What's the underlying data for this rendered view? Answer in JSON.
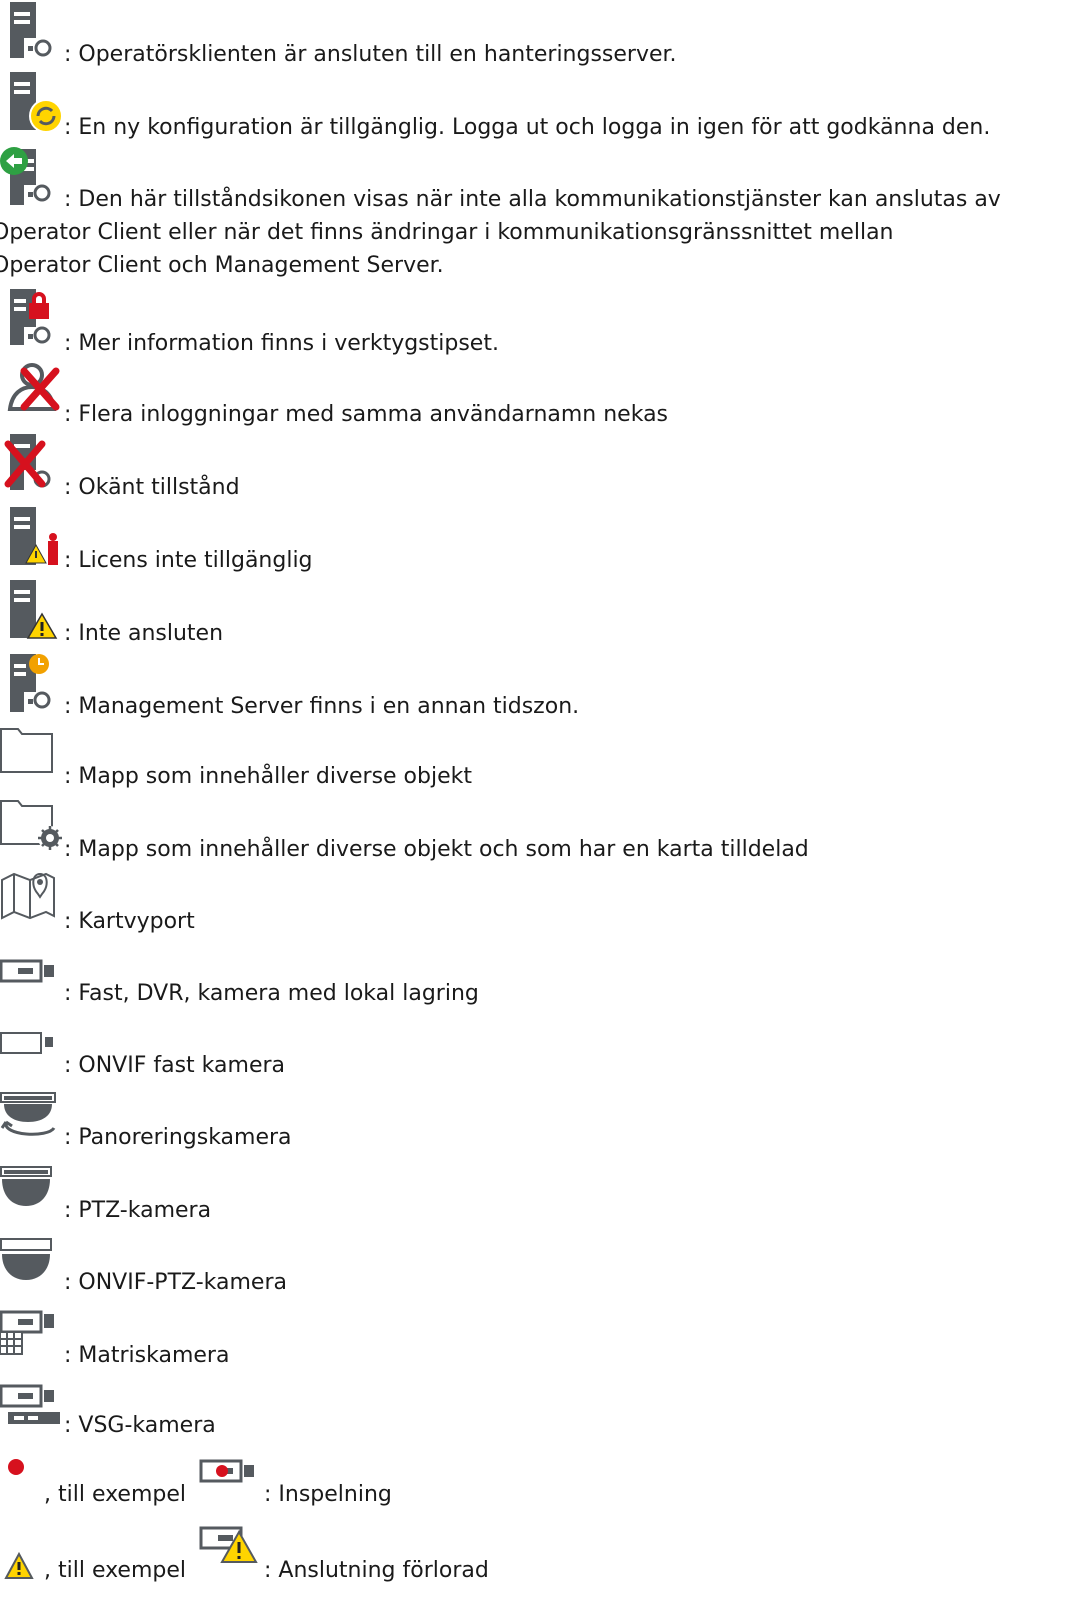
{
  "items": [
    {
      "icon": "server-connected-icon",
      "text": ": Operatörsklienten är ansluten till en hanteringsserver."
    },
    {
      "icon": "server-new-config-icon",
      "text": ": En ny konfiguration är tillgänglig. Logga ut och logga in igen för att godkänna den."
    },
    {
      "icon": "server-communication-warning-icon",
      "text_lines": [
        ": Den här tillståndsikonen visas när inte alla kommunikationstjänster kan anslutas av",
        "Operator Client eller när det finns ändringar i kommunikationsgränssnittet mellan",
        "Operator Client och Management Server."
      ]
    },
    {
      "icon": "server-locked-icon",
      "text": ": Mer information finns i verktygstipset."
    },
    {
      "icon": "user-denied-icon",
      "text": ": Flera inloggningar med samma användarnamn nekas"
    },
    {
      "icon": "server-unknown-icon",
      "text": ": Okänt tillstånd"
    },
    {
      "icon": "server-license-icon",
      "text": ": Licens inte tillgänglig"
    },
    {
      "icon": "server-not-connected-icon",
      "text": ": Inte ansluten"
    },
    {
      "icon": "server-timezone-icon",
      "text": ": Management Server finns i en annan tidszon."
    },
    {
      "icon": "folder-icon",
      "text": ": Mapp som innehåller diverse objekt"
    },
    {
      "icon": "folder-map-icon",
      "text": ": Mapp som innehåller diverse objekt och som har en karta tilldelad"
    },
    {
      "icon": "map-viewport-icon",
      "text": ": Kartvyport"
    },
    {
      "icon": "fixed-camera-icon",
      "text": ": Fast, DVR, kamera med lokal lagring"
    },
    {
      "icon": "onvif-fixed-camera-icon",
      "text": ": ONVIF fast kamera"
    },
    {
      "icon": "panoramic-camera-icon",
      "text": ": Panoreringskamera"
    },
    {
      "icon": "ptz-camera-icon",
      "text": ": PTZ-kamera"
    },
    {
      "icon": "onvif-ptz-camera-icon",
      "text": ": ONVIF-PTZ-kamera"
    },
    {
      "icon": "matrix-camera-icon",
      "text": ": Matriskamera"
    },
    {
      "icon": "vsg-camera-icon",
      "text": ": VSG-kamera"
    },
    {
      "icon": "recording-dot-icon",
      "text": ", till exempel",
      "icon2": "recording-camera-icon",
      "text2": ": Inspelning"
    },
    {
      "icon": "warning-triangle-icon",
      "text": ", till exempel",
      "icon2": "camera-lost-icon",
      "text2": ": Anslutning förlorad"
    }
  ],
  "colors": {
    "icon_gray": "#555a5f",
    "red": "#d6111e",
    "green": "#2ea043",
    "yellow": "#ffd400",
    "orange": "#f2a100",
    "text": "#1a1a1a"
  }
}
